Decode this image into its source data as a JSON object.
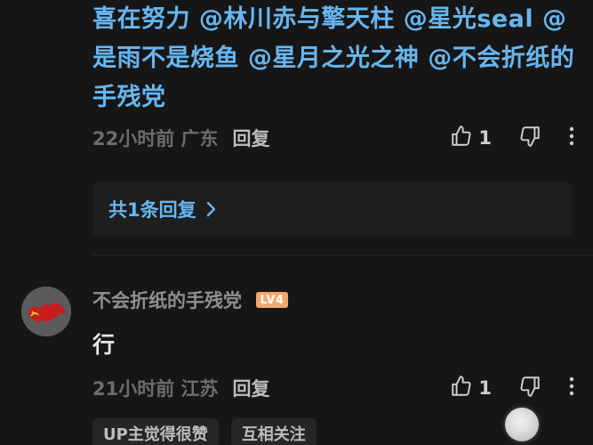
{
  "comment1": {
    "mention_lines": [
      "喜在努力 @林川赤与擎天柱 @星光seal @",
      "是雨不是烧鱼 @星月之光之神 @不会折纸的",
      "手残党"
    ],
    "time_location": "22小时前 广东",
    "reply_label": "回复",
    "like_count": "1",
    "replies_link": "共1条回复"
  },
  "comment2": {
    "username": "不会折纸的手残党",
    "level_badge": "LV4",
    "text": "行",
    "time_location": "21小时前 江苏",
    "reply_label": "回复",
    "like_count": "1",
    "tags": [
      "UP主觉得很赞",
      "互相关注"
    ]
  },
  "icons": {
    "like": "thumbs-up-icon",
    "dislike": "thumbs-down-icon",
    "more": "more-vertical-icon",
    "chevron": "chevron-right-icon"
  },
  "colors": {
    "background": "#161616",
    "mention_blue": "#67b6f0",
    "level_badge": "#f4a76a"
  }
}
